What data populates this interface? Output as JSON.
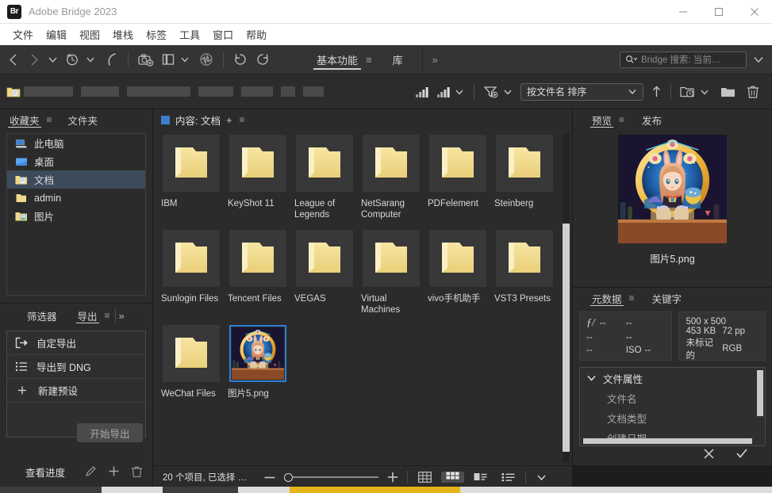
{
  "window": {
    "title": "Adobe Bridge 2023",
    "logo_text": "Br",
    "controls": [
      "minimize-button",
      "maximize-button",
      "close-button"
    ]
  },
  "menubar": {
    "items": [
      "文件",
      "编辑",
      "视图",
      "堆栈",
      "标签",
      "工具",
      "窗口",
      "帮助"
    ]
  },
  "toolbar": {
    "back_icon": "chevron-left-icon",
    "forward_icon": "chevron-right-icon",
    "dropdown_icon": "chevron-down-icon",
    "recent_icon": "recent-folders-icon",
    "boomerang_icon": "reveal-icon",
    "photo_downloader_icon": "photo-downloader-icon",
    "copy_icon": "copy-to-icon",
    "camera_raw_icon": "camera-raw-icon",
    "rotate_ccw_icon": "rotate-counterclockwise-icon",
    "rotate_cw_icon": "rotate-clockwise-icon",
    "workspace_tabs": [
      {
        "label": "基本功能",
        "active": true
      },
      {
        "label": "库",
        "active": false
      }
    ],
    "workspace_menu_icon": "hamburger-icon",
    "more_workspaces": "»",
    "search": {
      "placeholder": "Bridge 搜索: 当前…",
      "icon": "search-icon",
      "dropdown_icon": "chevron-down-icon"
    }
  },
  "pathbar": {
    "folder_icon": "documents-folder-icon",
    "redacted_segments": [
      62,
      48,
      80,
      44,
      40,
      18,
      26
    ],
    "filter_rating_icon": "rating-filter-icon",
    "filter_rating_menu_icon": "rating-filter-menu-icon",
    "filter_icon": "filter-funnel-icon",
    "sort_label": "按文件名 排序",
    "sort_caret": "chevron-down-icon",
    "sort_direction_icon": "sort-ascending-arrow-icon",
    "new_folder_recent_icon": "open-recent-folder-icon",
    "new_folder_icon": "new-folder-icon",
    "delete_icon": "trash-icon"
  },
  "favorites": {
    "tabs": [
      {
        "label": "收藏夹",
        "active": true
      },
      {
        "label": "文件夹",
        "active": false
      }
    ],
    "menu_icon": "hamburger-icon",
    "items": [
      {
        "label": "此电脑",
        "icon": "computer-icon",
        "selected": false
      },
      {
        "label": "桌面",
        "icon": "desktop-icon",
        "selected": false
      },
      {
        "label": "文档",
        "icon": "documents-icon",
        "selected": true
      },
      {
        "label": "admin",
        "icon": "folder-icon",
        "selected": false
      },
      {
        "label": "图片",
        "icon": "pictures-icon",
        "selected": false
      }
    ]
  },
  "export_panel": {
    "tabs": [
      {
        "label": "筛选器",
        "active": false
      },
      {
        "label": "导出",
        "active": true
      }
    ],
    "menu_icon": "hamburger-icon",
    "expand_icon": "double-chevron-right-icon",
    "rows": [
      {
        "label": "自定导出",
        "icon": "custom-export-icon"
      },
      {
        "label": "导出到 DNG",
        "icon": "list-icon"
      },
      {
        "label": "新建预设",
        "icon": "plus-icon"
      }
    ],
    "start_button": "开始导出",
    "progress_label": "查看进度",
    "edit_icon": "pencil-icon",
    "add_icon": "plus-icon",
    "delete_icon": "trash-icon"
  },
  "content": {
    "title": "内容: 文档",
    "marker_icon": "blue-square-icon",
    "add_icon": "plus-icon",
    "menu_icon": "hamburger-icon",
    "items": [
      {
        "name": "IBM",
        "type": "folder"
      },
      {
        "name": "KeyShot 11",
        "type": "folder"
      },
      {
        "name": "League of Legends",
        "type": "folder"
      },
      {
        "name": "NetSarang Computer",
        "type": "folder"
      },
      {
        "name": "PDFelement",
        "type": "folder"
      },
      {
        "name": "Steinberg",
        "type": "folder"
      },
      {
        "name": "Sunlogin Files",
        "type": "folder"
      },
      {
        "name": "Tencent Files",
        "type": "folder"
      },
      {
        "name": "VEGAS",
        "type": "folder"
      },
      {
        "name": "Virtual Machines",
        "type": "folder"
      },
      {
        "name": "vivo手机助手",
        "type": "folder"
      },
      {
        "name": "VST3 Presets",
        "type": "folder"
      },
      {
        "name": "WeChat Files",
        "type": "folder"
      },
      {
        "name": "图片5.png",
        "type": "image",
        "selected": true
      }
    ]
  },
  "statusbar": {
    "items_text": "20 个项目, 已选择 …",
    "zoom_out_icon": "minus-icon",
    "zoom_in_icon": "plus-icon",
    "view_modes": [
      {
        "name": "grid-lock-view",
        "active": false
      },
      {
        "name": "thumbnail-view",
        "active": true
      },
      {
        "name": "details-view",
        "active": false
      },
      {
        "name": "list-view",
        "active": false
      }
    ],
    "overflow_icon": "chevron-down-icon"
  },
  "preview": {
    "tabs": [
      {
        "label": "预览",
        "active": true
      },
      {
        "label": "发布",
        "active": false
      }
    ],
    "menu_icon": "hamburger-icon",
    "filename": "图片5.png"
  },
  "metadata": {
    "tabs": [
      {
        "label": "元数据",
        "active": true
      },
      {
        "label": "关键字",
        "active": false
      }
    ],
    "menu_icon": "hamburger-icon",
    "camera_card": {
      "aperture_icon": "f-stop-icon",
      "aperture": "--",
      "shutter": "--",
      "exposure": "--",
      "focal": "--",
      "compensation": "--",
      "iso_label": "ISO",
      "iso": "--"
    },
    "file_card": {
      "dimensions": "500 x 500",
      "filesize": "453 KB",
      "resolution": "72 pp",
      "color_profile": "未标记的",
      "color_mode": "RGB"
    },
    "properties": {
      "header": "文件属性",
      "expand_icon": "chevron-down-icon",
      "rows": [
        "文件名",
        "文档类型",
        "创建日期"
      ]
    },
    "cancel_icon": "close-icon",
    "confirm_icon": "check-icon"
  },
  "colors": {
    "accent_blue": "#2b7fd4",
    "panel_bg": "#2b2b2b",
    "toolbar_bg": "#343434",
    "selection_blue": "#3c4a5a",
    "folder_yellow": "#f3dd8c",
    "taskbar_yellow": "#e5b419"
  }
}
